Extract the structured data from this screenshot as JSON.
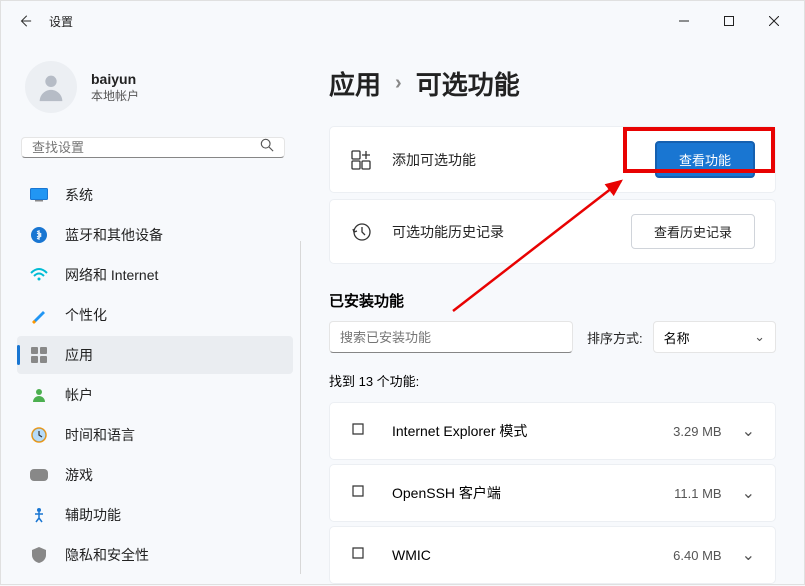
{
  "title": "设置",
  "user": {
    "name": "baiyun",
    "sub": "本地帐户"
  },
  "search": {
    "placeholder": "查找设置"
  },
  "nav": [
    {
      "label": "系统"
    },
    {
      "label": "蓝牙和其他设备"
    },
    {
      "label": "网络和 Internet"
    },
    {
      "label": "个性化"
    },
    {
      "label": "应用"
    },
    {
      "label": "帐户"
    },
    {
      "label": "时间和语言"
    },
    {
      "label": "游戏"
    },
    {
      "label": "辅助功能"
    },
    {
      "label": "隐私和安全性"
    }
  ],
  "breadcrumb": {
    "root": "应用",
    "leaf": "可选功能"
  },
  "cards": {
    "add": {
      "label": "添加可选功能",
      "button": "查看功能"
    },
    "history": {
      "label": "可选功能历史记录",
      "button": "查看历史记录"
    }
  },
  "installed": {
    "title": "已安装功能",
    "filter_placeholder": "搜索已安装功能",
    "sort_label": "排序方式:",
    "sort_value": "名称",
    "found": "找到 13 个功能:"
  },
  "features": [
    {
      "name": "Internet Explorer 模式",
      "size": "3.29 MB"
    },
    {
      "name": "OpenSSH 客户端",
      "size": "11.1 MB"
    },
    {
      "name": "WMIC",
      "size": "6.40 MB"
    }
  ]
}
